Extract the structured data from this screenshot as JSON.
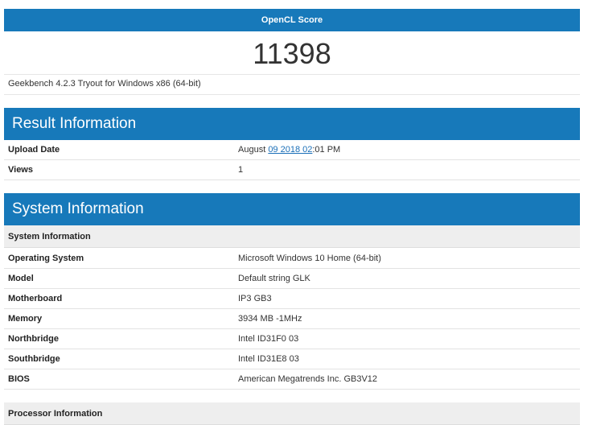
{
  "score": {
    "label": "OpenCL Score",
    "value": "11398"
  },
  "version_text": "Geekbench 4.2.3 Tryout for Windows x86 (64-bit)",
  "result_information": {
    "title": "Result Information",
    "rows": [
      {
        "key": "Upload Date",
        "value_prefix": "August ",
        "value_link": "09 2018 02",
        "value_suffix": ":01 PM"
      },
      {
        "key": "Views",
        "value": "1"
      }
    ]
  },
  "system_information": {
    "title": "System Information",
    "subheader": "System Information",
    "rows": [
      {
        "key": "Operating System",
        "value": "Microsoft Windows 10 Home (64-bit)"
      },
      {
        "key": "Model",
        "value": "Default string GLK"
      },
      {
        "key": "Motherboard",
        "value": "IP3 GB3"
      },
      {
        "key": "Memory",
        "value": "3934 MB -1MHz"
      },
      {
        "key": "Northbridge",
        "value": "Intel ID31F0 03"
      },
      {
        "key": "Southbridge",
        "value": "Intel ID31E8 03"
      },
      {
        "key": "BIOS",
        "value": "American Megatrends Inc. GB3V12"
      }
    ]
  },
  "processor_information": {
    "subheader": "Processor Information"
  },
  "colors": {
    "header_blue": "#1779ba",
    "subheader_gray": "#eeeeee",
    "link_blue": "#1a6fb8"
  }
}
